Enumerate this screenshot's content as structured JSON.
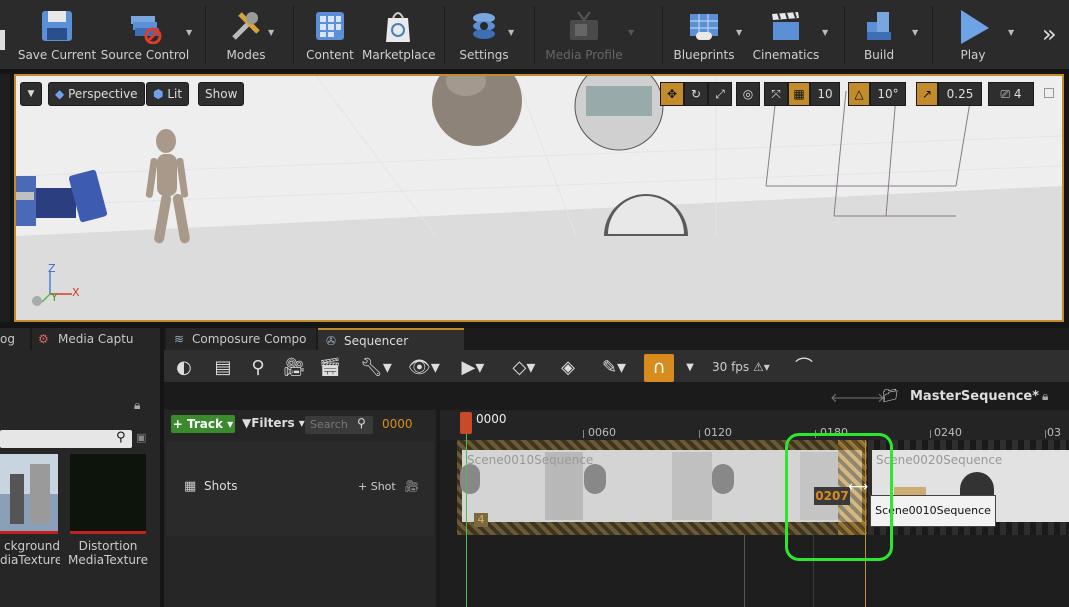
{
  "toolbar": {
    "buttons": [
      {
        "label": "Save Current",
        "icon": "save-icon"
      },
      {
        "label": "Source Control",
        "icon": "source-control-icon"
      },
      {
        "label": "Modes",
        "icon": "modes-icon"
      },
      {
        "label": "Content",
        "icon": "content-icon"
      },
      {
        "label": "Marketplace",
        "icon": "marketplace-icon"
      },
      {
        "label": "Settings",
        "icon": "settings-icon"
      },
      {
        "label": "Media Profile",
        "icon": "media-profile-icon"
      },
      {
        "label": "Blueprints",
        "icon": "blueprints-icon"
      },
      {
        "label": "Cinematics",
        "icon": "cinematics-icon"
      },
      {
        "label": "Build",
        "icon": "build-icon"
      },
      {
        "label": "Play",
        "icon": "play-icon"
      }
    ],
    "more": "»"
  },
  "viewport": {
    "perspective": "Perspective",
    "lit": "Lit",
    "show": "Show",
    "grid_snap": "10",
    "rot_snap": "10°",
    "scale_snap": "0.25",
    "camera_speed": "4",
    "axis_z": "Z",
    "axis_y": "Y",
    "axis_x": "X"
  },
  "left_panel": {
    "tab1": "og",
    "tab2": "Media Captu",
    "assets": [
      {
        "line1": "ckground",
        "line2": "diaTexture"
      },
      {
        "line1": "Distortion",
        "line2": "MediaTexture"
      }
    ]
  },
  "sequencer": {
    "tab_composure": "Composure Compo",
    "tab_sequencer": "Sequencer",
    "fps": "30 fps",
    "sequence_name": "MasterSequence*",
    "track_button": "+ Track",
    "filters": "Filters",
    "search_placeholder": "Search",
    "current_frame": "0000",
    "playhead_frame": "0000",
    "shots_label": "Shots",
    "add_shot": "+ Shot",
    "ruler": [
      "0060",
      "0120",
      "0180",
      "0240",
      "03"
    ],
    "section1_name": "Scene0010Sequence",
    "section1_badge": "4",
    "section2_name": "Scene0020Sequence",
    "drag_frame": "0207",
    "tooltip": "Scene0010Sequence"
  }
}
